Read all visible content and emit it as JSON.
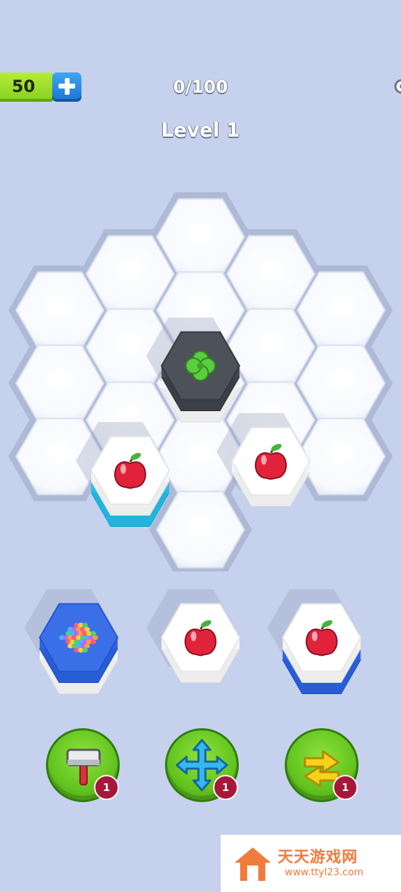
{
  "hud": {
    "coins": "50",
    "add_coins_icon": "plus-icon",
    "progress": "0/100",
    "level": "Level 1"
  },
  "board": {
    "empty_tile_color": "#ffffff",
    "placed_stacks": [
      {
        "item": "clover",
        "top_color": "#4d525a",
        "layers": [
          "#4d525a",
          "#ffffff"
        ]
      },
      {
        "item": "apple",
        "top_color": "#ffffff",
        "layers": [
          "#ffffff",
          "#33c6ef"
        ]
      },
      {
        "item": "apple",
        "top_color": "#ffffff",
        "layers": [
          "#ffffff"
        ]
      }
    ]
  },
  "tray": [
    {
      "item": "candies",
      "top_color": "#3b6fe8",
      "layers": [
        "#3b6fe8",
        "#ffffff"
      ]
    },
    {
      "item": "apple",
      "top_color": "#ffffff",
      "layers": [
        "#ffffff"
      ]
    },
    {
      "item": "apple",
      "top_color": "#ffffff",
      "layers": [
        "#ffffff",
        "#3b6fe8"
      ]
    }
  ],
  "boosters": [
    {
      "name": "hammer",
      "icon": "hammer-icon",
      "count": "1"
    },
    {
      "name": "move",
      "icon": "move-arrows-icon",
      "count": "1"
    },
    {
      "name": "swap",
      "icon": "swap-arrows-icon",
      "count": "1"
    }
  ],
  "watermark": {
    "text": "天天游戏网",
    "url": "www.ttyl23.com"
  }
}
